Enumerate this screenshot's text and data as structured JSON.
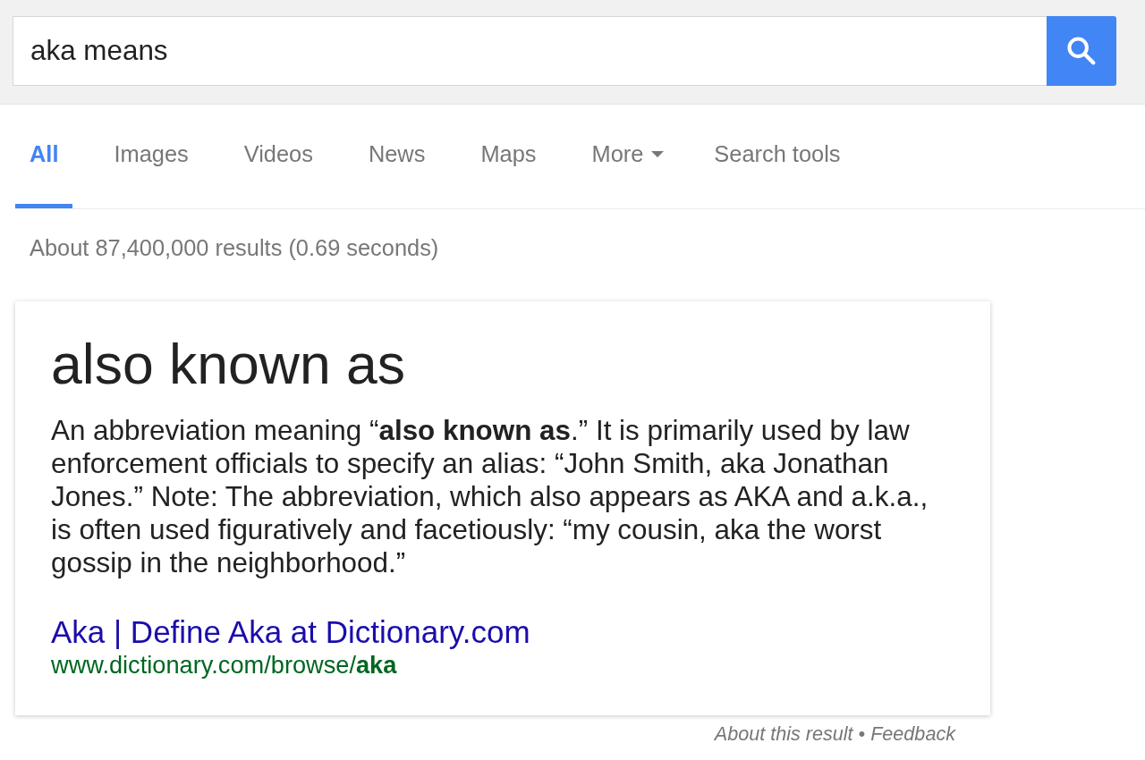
{
  "search": {
    "query": "aka means"
  },
  "tabs": [
    {
      "label": "All",
      "selected": true,
      "kind": "tab"
    },
    {
      "label": "Images",
      "selected": false,
      "kind": "tab"
    },
    {
      "label": "Videos",
      "selected": false,
      "kind": "tab"
    },
    {
      "label": "News",
      "selected": false,
      "kind": "tab"
    },
    {
      "label": "Maps",
      "selected": false,
      "kind": "tab"
    },
    {
      "label": "More",
      "selected": false,
      "kind": "menu"
    },
    {
      "label": "Search tools",
      "selected": false,
      "kind": "tools"
    }
  ],
  "result_stats": "About 87,400,000 results (0.69 seconds)",
  "answer_card": {
    "title": "also known as",
    "definition": "An abbreviation meaning “**also known as**.” It is primarily used by law enforcement officials to specify an alias: “John Smith, aka Jonathan Jones.” Note: The abbreviation, which also appears as AKA and a.k.a., is often used figuratively and facetiously: “my cousin, aka the worst gossip in the neighborhood.”",
    "source_title": "Aka | Define Aka at Dictionary.com",
    "source_url": "www.dictionary.com/browse/**aka**"
  },
  "footer": {
    "links": [
      "About this result",
      "Feedback"
    ],
    "separator": "•"
  }
}
